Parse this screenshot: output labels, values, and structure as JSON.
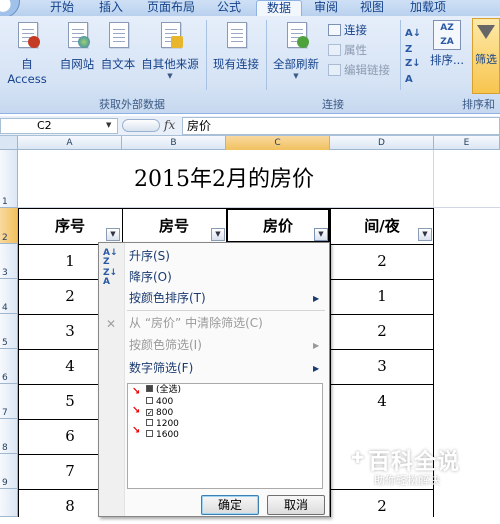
{
  "ribbon": {
    "tabs": [
      {
        "label": "开始",
        "active": false
      },
      {
        "label": "插入",
        "active": false
      },
      {
        "label": "页面布局",
        "active": false
      },
      {
        "label": "公式",
        "active": false
      },
      {
        "label": "数据",
        "active": true
      },
      {
        "label": "审阅",
        "active": false
      },
      {
        "label": "视图",
        "active": false
      },
      {
        "label": "加载项",
        "active": false
      }
    ],
    "get_external": {
      "access": "自 Access",
      "web": "自网站",
      "text": "自文本",
      "other": "自其他来源",
      "existing": "现有连接",
      "label": "获取外部数据"
    },
    "connections": {
      "refresh_all": "全部刷新",
      "connections": "连接",
      "properties": "属性",
      "edit_links": "编辑链接",
      "label": "连接"
    },
    "sort_filter": {
      "sort": "排序...",
      "filter": "筛选",
      "label": "排序和"
    }
  },
  "formula_bar": {
    "name_box": "C2",
    "fx": "fx",
    "value": "房价"
  },
  "grid": {
    "columns": [
      "A",
      "B",
      "C",
      "D",
      "E"
    ],
    "rows": [
      "1",
      "2",
      "3",
      "4",
      "5",
      "6",
      "7",
      "8",
      "9"
    ]
  },
  "sheet": {
    "title": "2015年2月的房价",
    "headers": [
      "序号",
      "房号",
      "房价",
      "间/夜"
    ],
    "col_a": [
      "1",
      "2",
      "3",
      "4",
      "5",
      "6",
      "7",
      "8"
    ],
    "col_d": [
      "2",
      "1",
      "2",
      "3",
      "4",
      "2"
    ]
  },
  "filter_menu": {
    "sort_asc": "升序(S)",
    "sort_desc": "降序(O)",
    "sort_by_color": "按颜色排序(T)",
    "clear_filter": "从 “房价” 中清除筛选(C)",
    "filter_by_color": "按颜色筛选(I)",
    "number_filter": "数字筛选(F)",
    "select_all": "(全选)",
    "values": [
      {
        "label": "400",
        "checked": false
      },
      {
        "label": "800",
        "checked": true
      },
      {
        "label": "1200",
        "checked": false
      },
      {
        "label": "1600",
        "checked": false
      }
    ],
    "ok": "确定",
    "cancel": "取消"
  },
  "watermark": {
    "main": "百科全说",
    "sub": "助你轻松解决"
  },
  "colors": {
    "ribbon_text": "#15428b",
    "selected_header": "#f1c15f",
    "red_arrow": "#e00000"
  }
}
